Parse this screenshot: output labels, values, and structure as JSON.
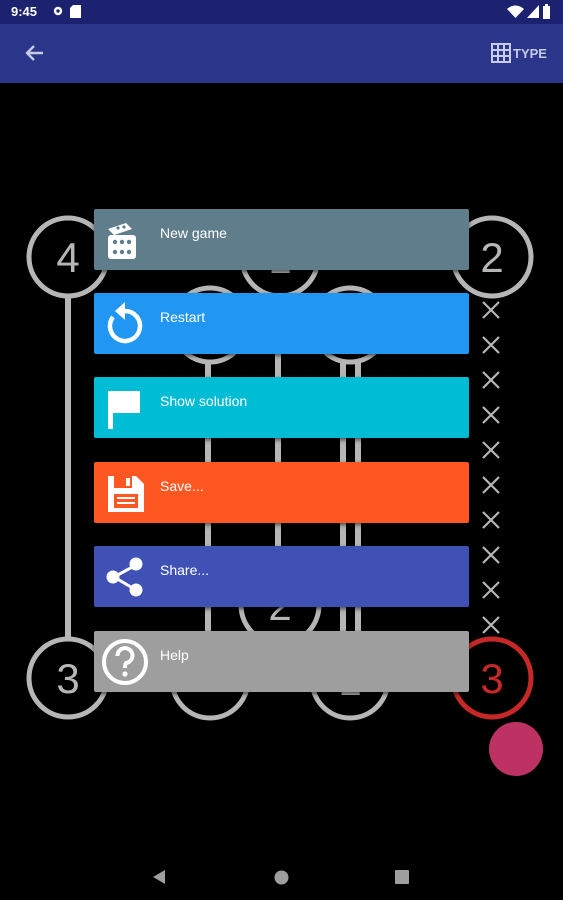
{
  "status_bar": {
    "time": "9:45"
  },
  "app_bar": {
    "type_label": "TYPE"
  },
  "puzzle": {
    "islands": [
      "4",
      "1",
      "2",
      "3",
      "2",
      "3",
      "3",
      "1"
    ]
  },
  "menu": {
    "items": [
      {
        "label": "New game",
        "color": "#607d8b",
        "icon": "dice-icon"
      },
      {
        "label": "Restart",
        "color": "#2196f3",
        "icon": "restart-icon"
      },
      {
        "label": "Show solution",
        "color": "#00bcd4",
        "icon": "flag-icon"
      },
      {
        "label": "Save...",
        "color": "#ff5722",
        "icon": "floppy-disk-icon"
      },
      {
        "label": "Share...",
        "color": "#3f51b5",
        "icon": "share-icon"
      },
      {
        "label": "Help",
        "color": "#9e9e9e",
        "icon": "help-icon"
      }
    ]
  },
  "colors": {
    "status_bar": "#1d2270",
    "app_bar": "#2b3589",
    "island_stroke": "#b6b6b6",
    "error_island": "#c62828",
    "fab": "#bd3163"
  }
}
